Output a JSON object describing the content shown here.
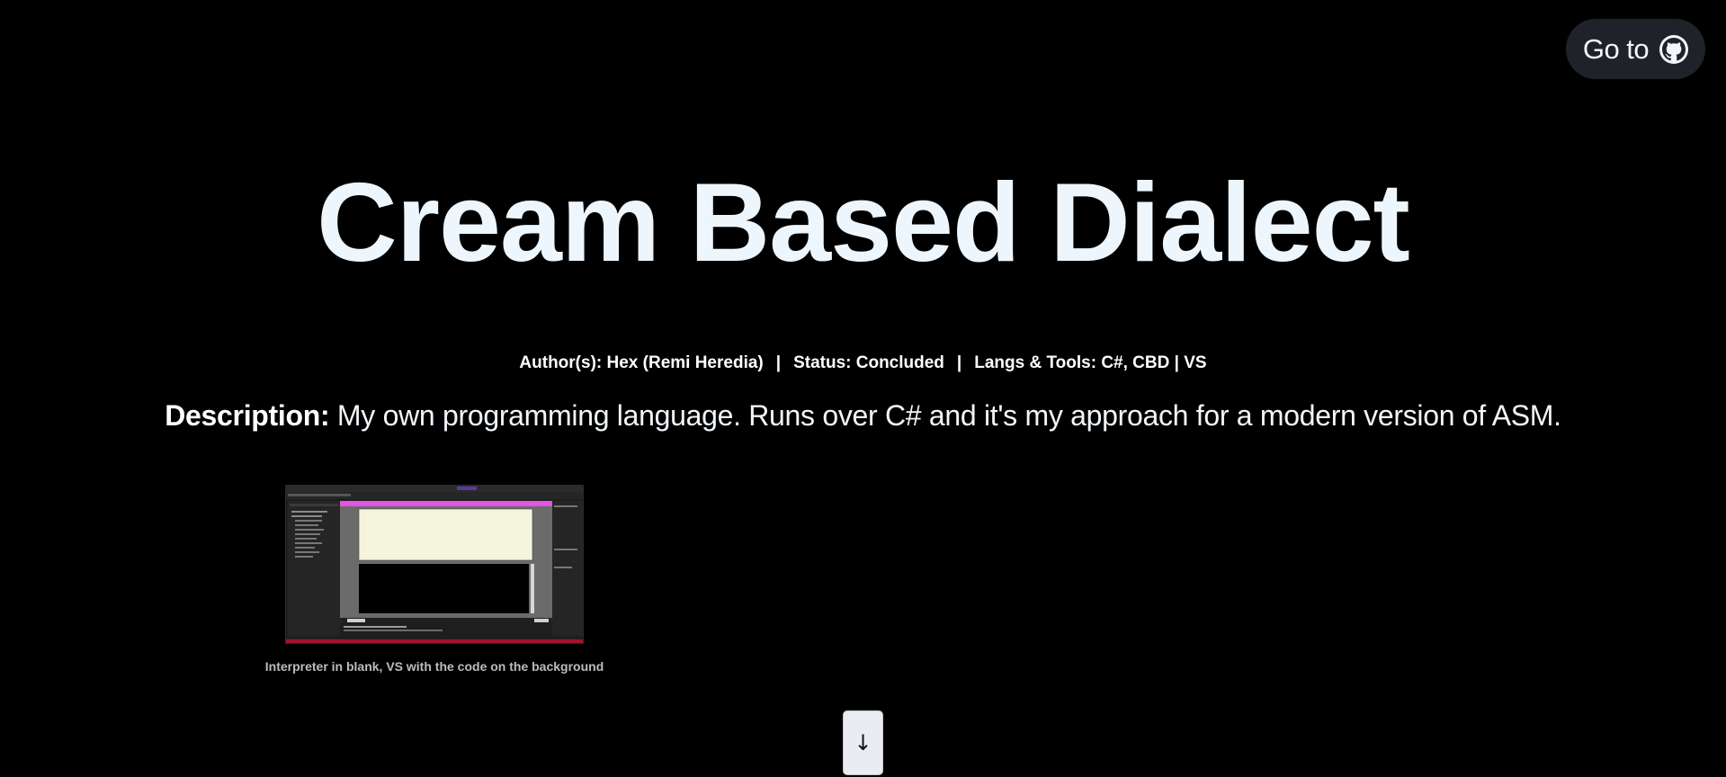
{
  "header": {
    "goto_label": "Go to",
    "goto_icon": "github-icon"
  },
  "project": {
    "title": "Cream Based Dialect",
    "author": "Author(s): Hex (Remi Heredia)",
    "separator": "|",
    "status": "Status: Concluded",
    "tools": "Langs & Tools: C#, CBD | VS",
    "description_label": "Description:",
    "description_text": " My own programming language. Runs over C# and it's my approach for a modern version of ASM."
  },
  "gallery": {
    "caption": "Interpreter in blank, VS with the code on the background"
  },
  "scroll": {
    "icon": "arrow-down-icon",
    "glyph": "↓"
  },
  "colors": {
    "background": "#000000",
    "title": "#eef6fd",
    "button_bg": "#1f2329",
    "interpreter_titlebar": "#e353e6",
    "interpreter_editor": "#f4f3dc",
    "vs_statusbar": "#a3132d"
  }
}
